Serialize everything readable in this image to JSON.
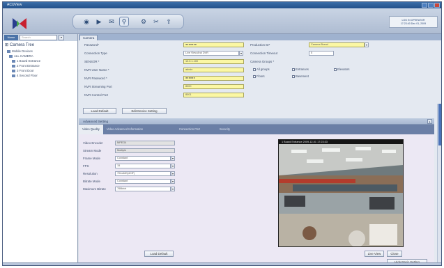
{
  "app": {
    "title": "ACUView"
  },
  "clock": {
    "line1": "LOG IN OPERATOR",
    "line2": "17:23:40 Dec 01, 2009"
  },
  "toolbar": {
    "buttons": [
      {
        "icon": "live-view-icon"
      },
      {
        "icon": "playback-icon"
      },
      {
        "icon": "event-icon"
      },
      {
        "icon": "search-icon"
      },
      {
        "icon": "configuration-icon"
      },
      {
        "icon": "tools-icon"
      },
      {
        "icon": "export-icon"
      }
    ]
  },
  "left": {
    "name_btn": "Name",
    "search_placeholder": "Search",
    "tree_title": "Camera Tree",
    "items": [
      {
        "label": "Mobile Devices"
      },
      {
        "label": "ALL CAMERA"
      },
      {
        "label": "1 Board Entrance"
      },
      {
        "label": "2 Front Entrance"
      },
      {
        "label": "3 Front Door"
      },
      {
        "label": "4 Second Floor"
      }
    ]
  },
  "main": {
    "tab_label": "Camera",
    "form": {
      "password_label": "Password*",
      "password_value": "●●●●●●●",
      "connection_type_label": "Connection Type",
      "connection_type_value": "Live View And DVR",
      "sensor_label": "SENSOR *",
      "sensor_value": "10.0.1.100",
      "nvr_user_label": "NVR User Name *",
      "nvr_user_value": "admin",
      "nvr_password_label": "NVR Password *",
      "nvr_password_value": "●●●●●●",
      "nvr_streaming_label": "NVR Streaming Port",
      "nvr_streaming_value": "8000",
      "nvr_control_label": "NVR Control Port",
      "nvr_control_value": "8001",
      "production_label": "Production ID*",
      "production_value": "Camera Brand",
      "connection_timeout_label": "Connection Timeout",
      "connection_timeout_value": "5",
      "camera_groups_label": "Camera Groups *",
      "checkboxes": [
        "All groups",
        "Entrances",
        "Elevators",
        "Floors",
        "Basement"
      ],
      "load_default": "Load Default",
      "edit_device_setting": "Edit Device Setting"
    },
    "advanced": {
      "header": "Advanced Setting",
      "subtabs": [
        "Video Quality",
        "Video Advanced Information",
        "Connection Port",
        "Security"
      ],
      "fields": [
        {
          "label": "Video Encoder",
          "value": "MPEG4"
        },
        {
          "label": "Stream Mode",
          "value": "Multiple"
        },
        {
          "label": "Frame Mode",
          "value": "Constant"
        },
        {
          "label": "FPS",
          "value": "15"
        },
        {
          "label": "Resolution",
          "value": "704x480(4CIF)"
        },
        {
          "label": "Bitrate Mode",
          "value": "Constant"
        },
        {
          "label": "Maximum Bitrate",
          "value": "768kb/s"
        }
      ],
      "load_default": "Load Default",
      "video_title": "1 Board Entrance    2009-12-01 17:23:33",
      "live_view": "Live View",
      "close": "Close",
      "hide_basic": "Hide Basic Setting"
    }
  },
  "colors": {
    "accent": "#4a72b8",
    "field_required": "#fbf7a4",
    "titlebar": "#2e5c98"
  }
}
